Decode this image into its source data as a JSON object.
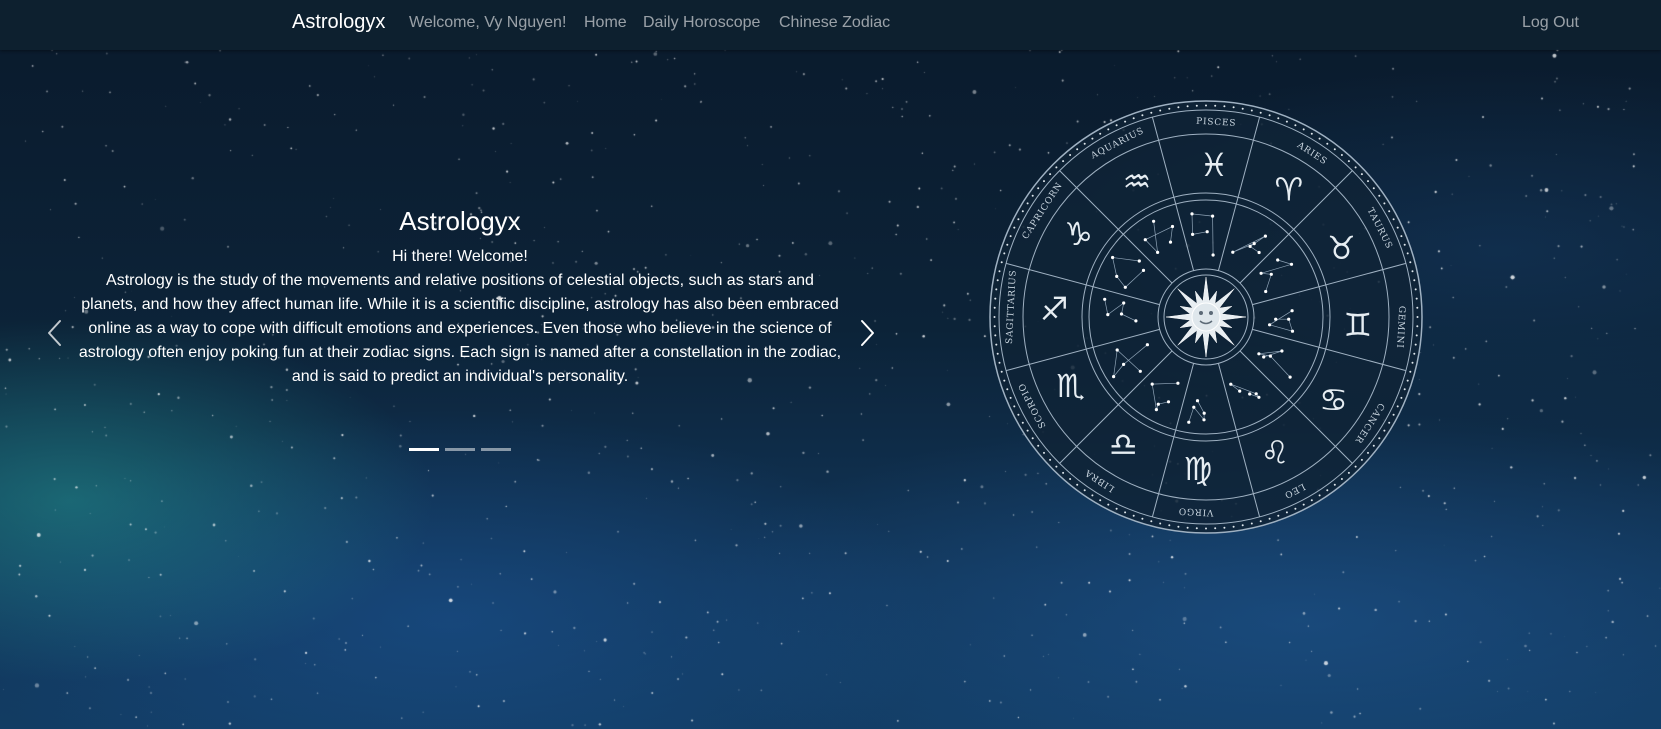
{
  "navbar": {
    "brand": "Astrologyx",
    "welcome": "Welcome, Vy Nguyen!",
    "home": "Home",
    "daily_horoscope": "Daily Horoscope",
    "chinese_zodiac": "Chinese Zodiac",
    "logout": "Log Out"
  },
  "carousel": {
    "title": "Astrologyx",
    "greeting": "Hi there! Welcome!",
    "body": "Astrology is the study of the movements and relative positions of celestial objects, such as stars and planets, and how they affect human life. While it is a scientific discipline, astrology has also been embraced online as a way to cope with difficult emotions and experiences. Even those who believe in the science of astrology often enjoy poking fun at their zodiac signs. Each sign is named after a constellation in the zodiac, and is said to predict an individual's personality.",
    "active_slide": 1,
    "slide_count": 3,
    "prev_icon": "chevron-left-icon",
    "next_icon": "chevron-right-icon"
  },
  "zodiac_wheel": {
    "signs": [
      "PISCES",
      "ARIES",
      "TAURUS",
      "GEMINI",
      "CANCER",
      "LEO",
      "VIRGO",
      "LIBRA",
      "SCORPIO",
      "SAGITTARIUS",
      "CAPRICORN",
      "AQUARIUS"
    ],
    "symbols": [
      "♓",
      "♈",
      "♉",
      "♊",
      "♋",
      "♌",
      "♍",
      "♎",
      "♏",
      "♐",
      "♑",
      "♒"
    ],
    "center_icon": "sun-icon"
  },
  "colors": {
    "navbar_bg": "#0e2130",
    "text": "#ffffff",
    "nav_link": "#9aa4ad",
    "wheel_line": "#9fb1c2"
  }
}
